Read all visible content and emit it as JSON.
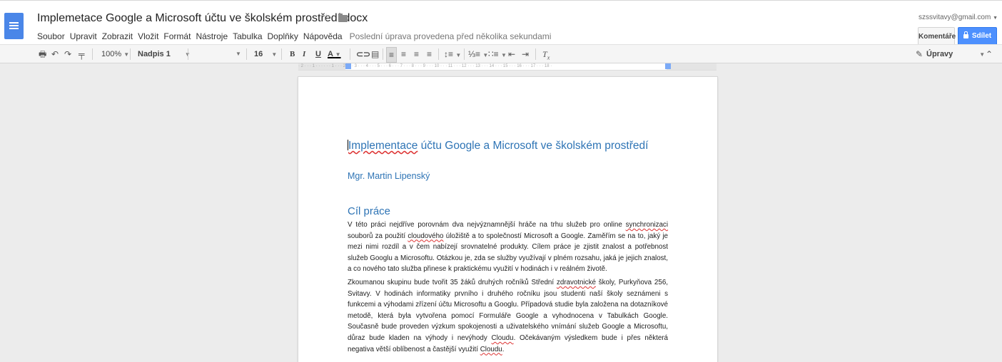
{
  "document": {
    "title": "Implemetace Google a Microsoft účtu ve školském prostředí.docx",
    "last_edit": "Poslední úprava provedena před několika sekundami"
  },
  "account": {
    "email": "szssvitavy@gmail.com"
  },
  "buttons": {
    "comments": "Komentáře",
    "share": "Sdílet"
  },
  "menu": [
    "Soubor",
    "Upravit",
    "Zobrazit",
    "Vložit",
    "Formát",
    "Nástroje",
    "Tabulka",
    "Doplňky",
    "Nápověda"
  ],
  "toolbar": {
    "zoom": "100%",
    "style": "Nadpis 1",
    "font": "",
    "font_size": "16",
    "bold": "B",
    "italic": "I",
    "underline": "U",
    "text_color": "A",
    "mode": "Úpravy"
  },
  "ruler": {
    "marks": "· 2 · · · 1 · · · · · · 1 · · · 2 · · · 3 · · · 4 · · · 5 · · · 6 · · · 7 · · · 8 · · · 9 · · · 10 · · · 11 · · · 12 · · · 13 · · · 14 · · · 15 · · · 16 · · · 17 · · · 18 ·"
  },
  "content": {
    "heading_word_1": "Implementace",
    "heading_rest": " účtu Google a Microsoft ve školském prostředí",
    "author": "Mgr. Martin Lipenský",
    "section": "Cíl práce",
    "p1_a": "V této práci nejdříve porovnám dva nejvýznamnější hráče na trhu služeb pro online ",
    "p1_w1": "synchronizaci",
    "p1_b": " souborů za použití ",
    "p1_w2": "cloudového",
    "p1_c": " úložiště a to společností Microsoft a Google.  Zaměřím se na to, jaký je mezi nimi rozdíl a v čem nabízejí srovnatelné produkty. Cílem práce je zjistit znalost a potřebnost služeb Googlu   a Microsoftu. Otázkou je, zda se služby využívají v plném rozsahu, jaká je jejich znalost, a co nového tato služba přinese k praktickému využití v hodinách i v reálném životě.",
    "p2_a": "Zkoumanou skupinu bude tvořit 35 žáků druhých ročníků Střední ",
    "p2_w1": "zdravotnické",
    "p2_b": " školy, Purkyňova 256, Svitavy.  V hodinách informatiky prvního i druhého ročníku jsou studenti naší školy seznámeni s funkcemi a výhodami zřízení účtu Microsoftu a Googlu. Případová studie byla založena na dotazníkové metodě, která byla vytvořena pomocí Formuláře Google a vyhodnocena v Tabulkách Google. Současně bude proveden výzkum spokojenosti a uživatelského vnímání služeb Google a Microsoftu, důraz bude kladen na výhody i nevýhody ",
    "p2_w2": "Cloudu",
    "p2_c": ". Očekávaným výsledkem bude i přes některá negativa větší oblíbenost a častější využití ",
    "p2_w3": "Cloudu",
    "p2_d": "."
  }
}
